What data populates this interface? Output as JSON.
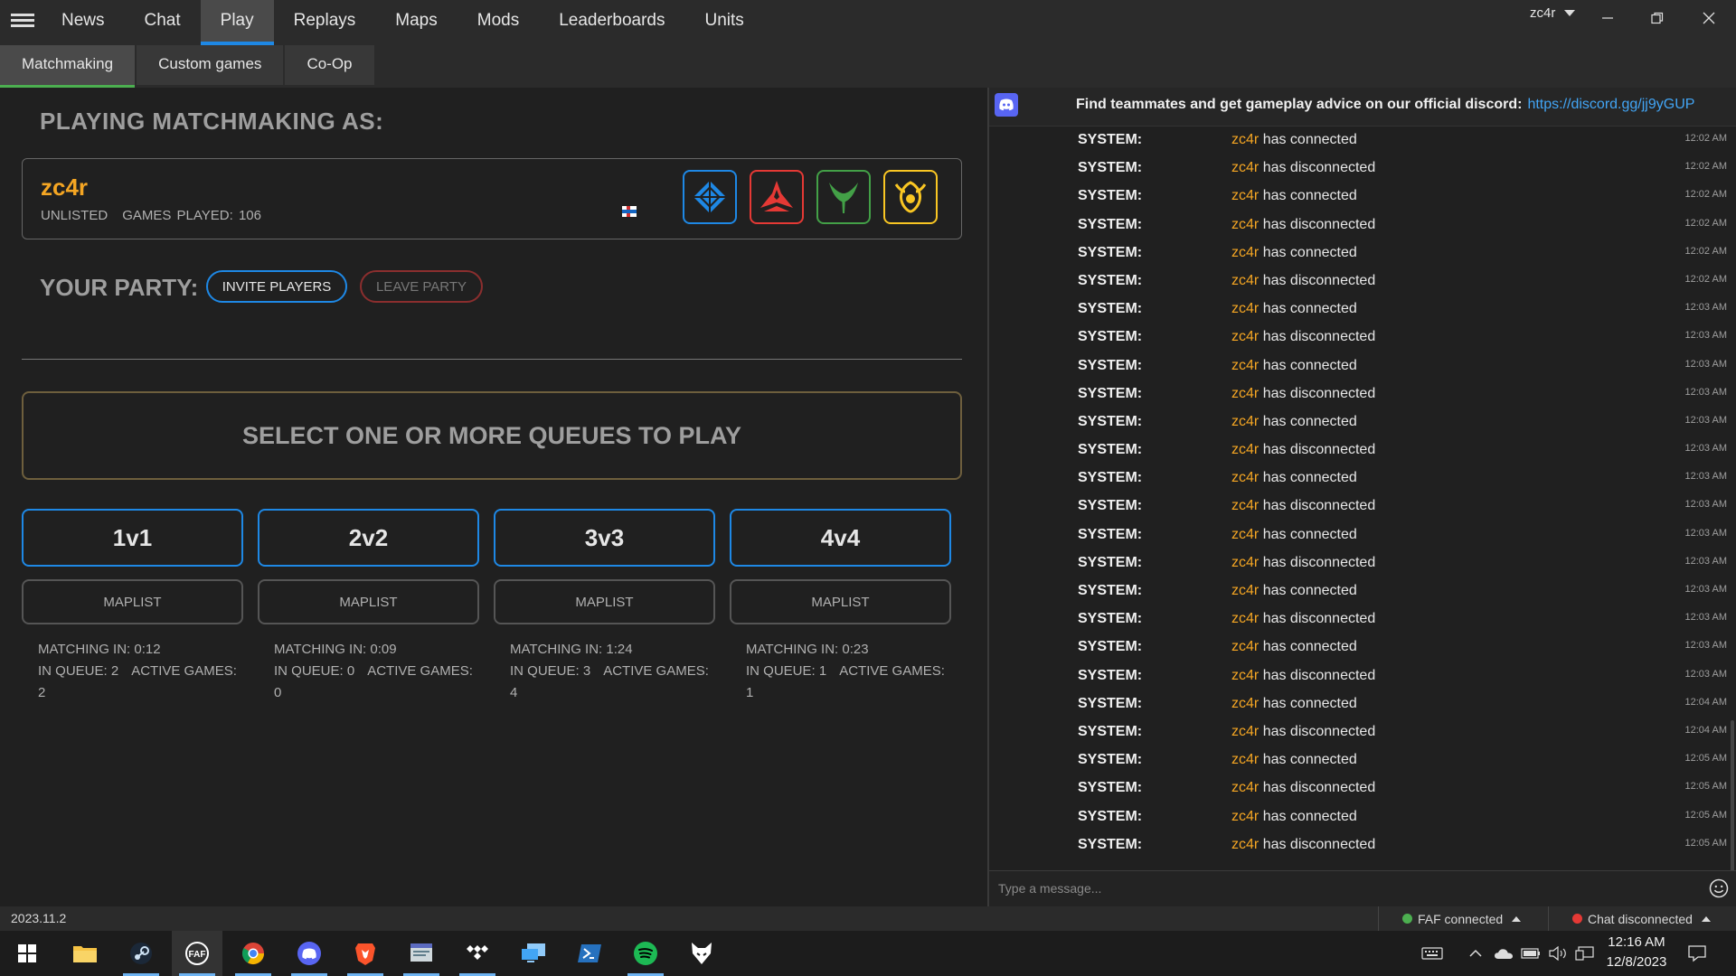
{
  "nav": {
    "tabs": [
      "News",
      "Chat",
      "Play",
      "Replays",
      "Maps",
      "Mods",
      "Leaderboards",
      "Units"
    ],
    "active": "Play",
    "user": "zc4r"
  },
  "subtabs": [
    "Matchmaking",
    "Custom games",
    "Co-Op"
  ],
  "play": {
    "playing_as": "PLAYING MATCHMAKING AS:",
    "player_name": "zc4r",
    "rank": "UNLISTED",
    "games_played": "GAMES PLAYED: 106",
    "factions": [
      "uef-icon",
      "cybran-icon",
      "aeon-icon",
      "seraphim-icon"
    ],
    "your_party": "YOUR PARTY:",
    "invite": "INVITE PLAYERS",
    "leave": "LEAVE PARTY",
    "select_msg": "SELECT ONE OR MORE QUEUES TO PLAY",
    "queues": [
      {
        "name": "1v1",
        "maplist": "MAPLIST",
        "matching": "MATCHING IN: 0:12",
        "in_queue": "IN QUEUE: 2",
        "active": "ACTIVE GAMES: 2"
      },
      {
        "name": "2v2",
        "maplist": "MAPLIST",
        "matching": "MATCHING IN: 0:09",
        "in_queue": "IN QUEUE: 0",
        "active": "ACTIVE GAMES: 0"
      },
      {
        "name": "3v3",
        "maplist": "MAPLIST",
        "matching": "MATCHING IN: 1:24",
        "in_queue": "IN QUEUE: 3",
        "active": "ACTIVE GAMES: 4"
      },
      {
        "name": "4v4",
        "maplist": "MAPLIST",
        "matching": "MATCHING IN: 0:23",
        "in_queue": "IN QUEUE: 1",
        "active": "ACTIVE GAMES: 1"
      }
    ]
  },
  "chat": {
    "header": "Find teammates and get gameplay advice on our official discord:",
    "link": "https://discord.gg/jj9yGUP",
    "sender": "SYSTEM:",
    "nick": "zc4r",
    "messages": [
      {
        "text": "has connected",
        "time": "12:02 AM"
      },
      {
        "text": "has disconnected",
        "time": "12:02 AM"
      },
      {
        "text": "has connected",
        "time": "12:02 AM"
      },
      {
        "text": "has disconnected",
        "time": "12:02 AM"
      },
      {
        "text": "has connected",
        "time": "12:02 AM"
      },
      {
        "text": "has disconnected",
        "time": "12:02 AM"
      },
      {
        "text": "has connected",
        "time": "12:03 AM"
      },
      {
        "text": "has disconnected",
        "time": "12:03 AM"
      },
      {
        "text": "has connected",
        "time": "12:03 AM"
      },
      {
        "text": "has disconnected",
        "time": "12:03 AM"
      },
      {
        "text": "has connected",
        "time": "12:03 AM"
      },
      {
        "text": "has disconnected",
        "time": "12:03 AM"
      },
      {
        "text": "has connected",
        "time": "12:03 AM"
      },
      {
        "text": "has disconnected",
        "time": "12:03 AM"
      },
      {
        "text": "has connected",
        "time": "12:03 AM"
      },
      {
        "text": "has disconnected",
        "time": "12:03 AM"
      },
      {
        "text": "has connected",
        "time": "12:03 AM"
      },
      {
        "text": "has disconnected",
        "time": "12:03 AM"
      },
      {
        "text": "has connected",
        "time": "12:03 AM"
      },
      {
        "text": "has disconnected",
        "time": "12:03 AM"
      },
      {
        "text": "has connected",
        "time": "12:04 AM"
      },
      {
        "text": "has disconnected",
        "time": "12:04 AM"
      },
      {
        "text": "has connected",
        "time": "12:05 AM"
      },
      {
        "text": "has disconnected",
        "time": "12:05 AM"
      },
      {
        "text": "has connected",
        "time": "12:05 AM"
      },
      {
        "text": "has disconnected",
        "time": "12:05 AM"
      }
    ],
    "input_placeholder": "Type a message..."
  },
  "status": {
    "version": "2023.11.2",
    "faf": "FAF connected",
    "chat": "Chat disconnected",
    "faf_color": "#4caf50",
    "chat_color": "#e53935"
  },
  "taskbar": {
    "icons": [
      "windows-start-icon",
      "file-explorer-icon",
      "steam-icon",
      "faf-client-icon",
      "chrome-icon",
      "discord-icon",
      "brave-icon",
      "app-window-icon",
      "tidal-icon",
      "remote-desktop-icon",
      "powershell-icon",
      "spotify-icon",
      "fox-app-icon"
    ],
    "time": "12:16 AM",
    "date": "12/8/2023"
  },
  "colors": {
    "accent": "#1e88e5",
    "nick": "#f5a623",
    "subtab_accent": "#4caf50"
  }
}
